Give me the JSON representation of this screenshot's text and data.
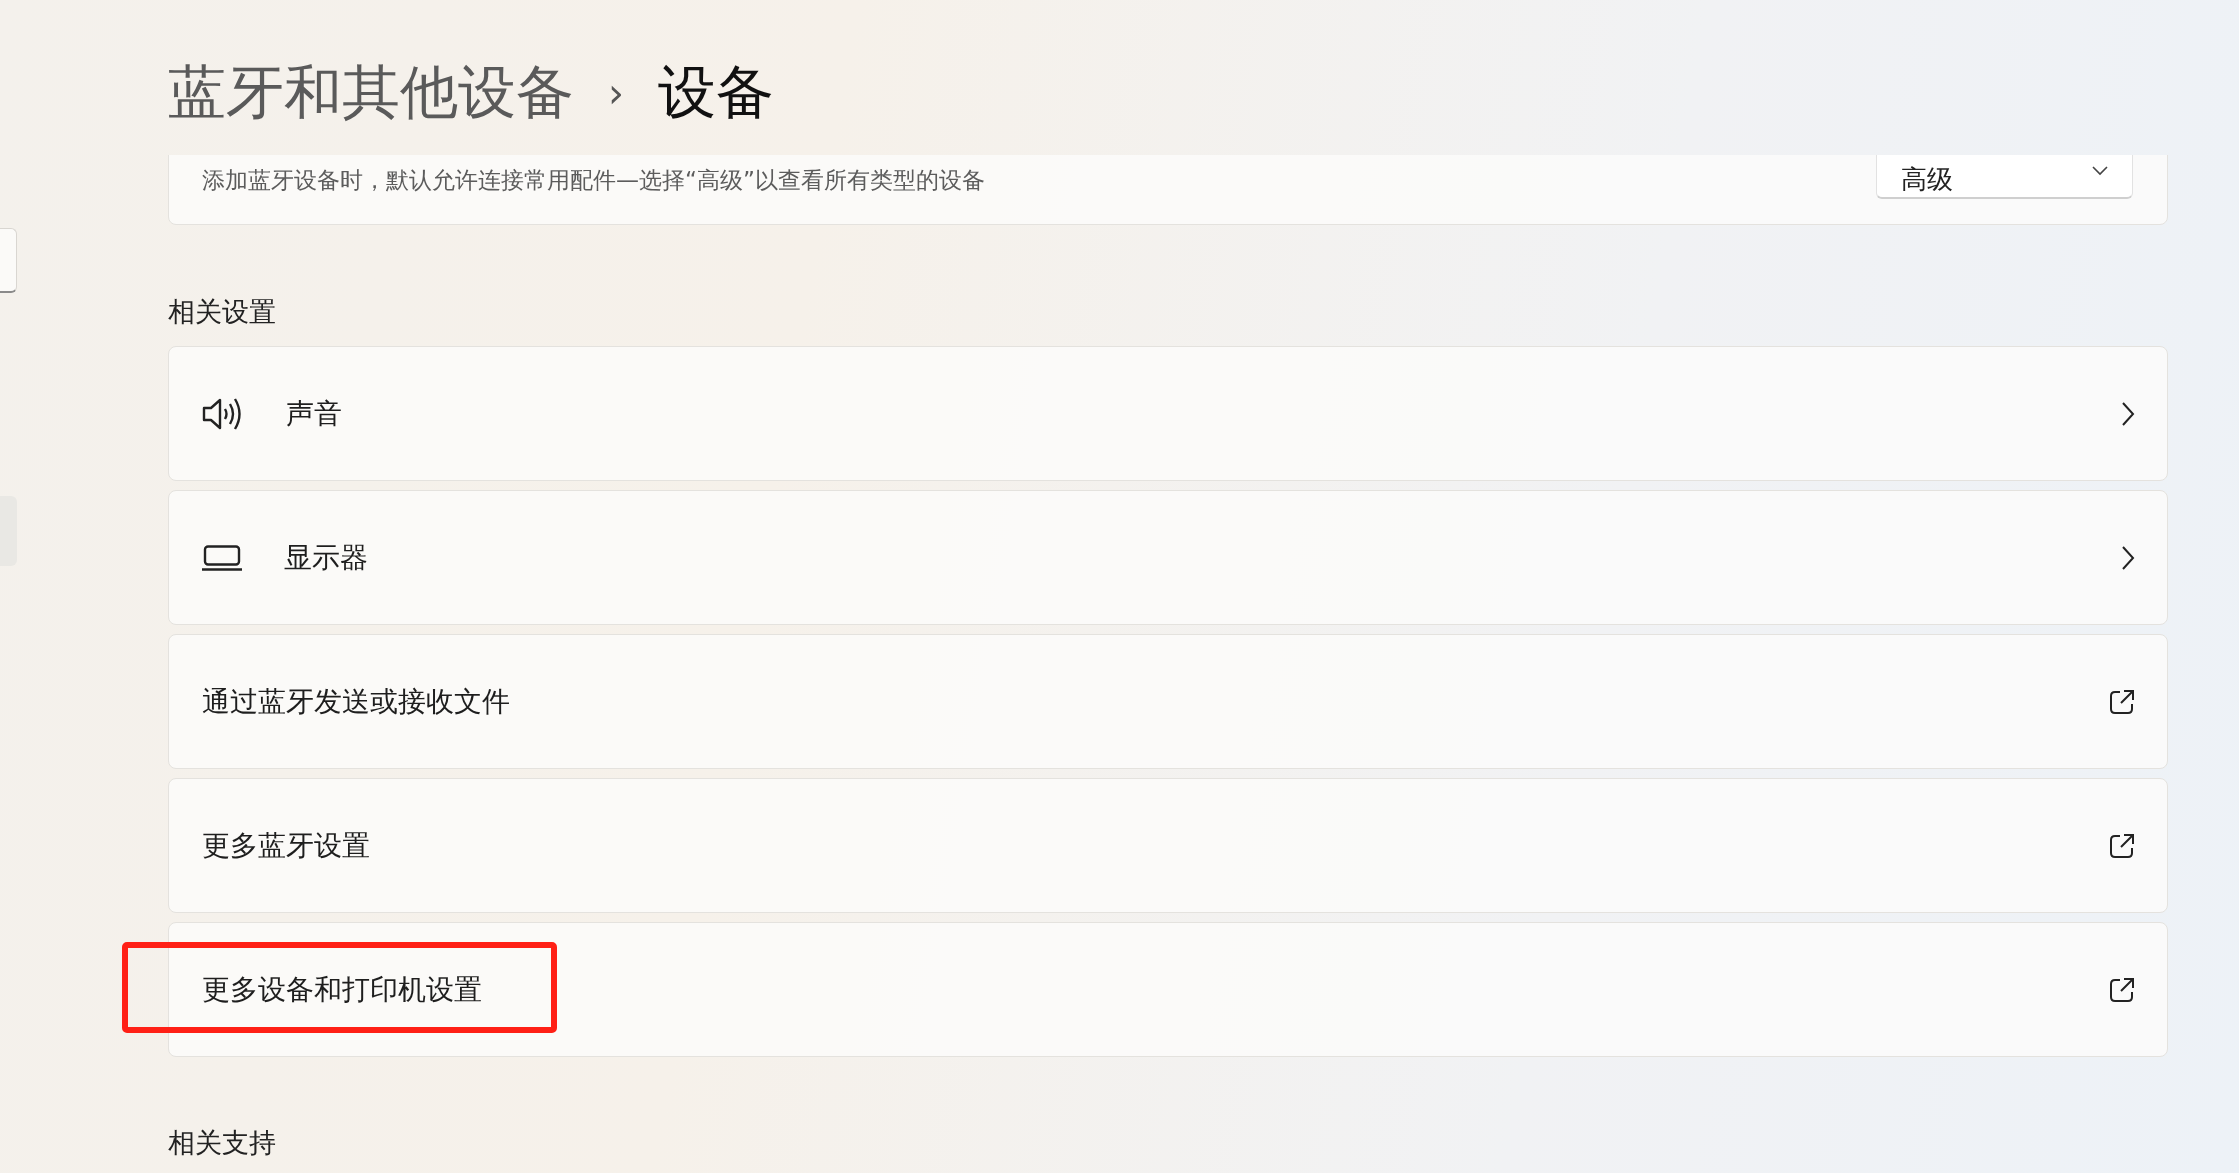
{
  "breadcrumb": {
    "parent": "蓝牙和其他设备",
    "separator": "›",
    "current": "设备"
  },
  "discovery_card": {
    "description": "添加蓝牙设备时，默认允许连接常用配件—选择“高级”以查看所有类型的设备",
    "dropdown": {
      "value": "高级"
    }
  },
  "related_settings": {
    "heading": "相关设置",
    "items": [
      {
        "label": "声音",
        "kind": "sound",
        "highlighted": false
      },
      {
        "label": "显示器",
        "kind": "display",
        "highlighted": false
      },
      {
        "label": "通过蓝牙发送或接收文件",
        "kind": "external",
        "highlighted": false
      },
      {
        "label": "更多蓝牙设置",
        "kind": "external",
        "highlighted": false
      },
      {
        "label": "更多设备和打印机设置",
        "kind": "external",
        "highlighted": true
      }
    ]
  },
  "related_support": {
    "heading": "相关支持"
  }
}
